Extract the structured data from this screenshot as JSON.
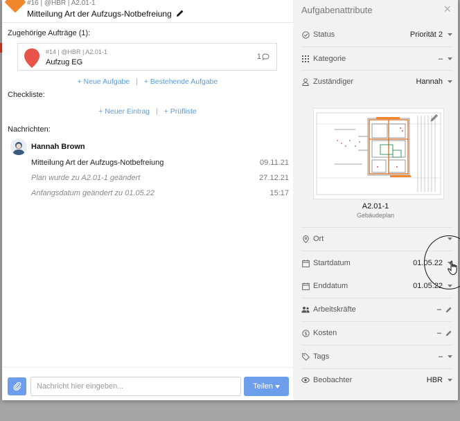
{
  "task": {
    "meta": "#16 | @HBR | A2.01-1",
    "title": "Mitteilung Art der Aufzugs-Notbefreiung"
  },
  "related": {
    "label": "Zugehörige Aufträge (1):",
    "card": {
      "meta": "#14 | @HBR | A2.01-1",
      "title": "Aufzug EG",
      "comment_count": "1"
    },
    "new_task_link": "+ Neue Aufgabe",
    "separator": "|",
    "existing_task_link": "+ Bestehende Aufgabe"
  },
  "checklist": {
    "label": "Checkliste:",
    "new_entry_link": "+ Neuer Eintrag",
    "separator": "|",
    "checklist_link": "+ Prüfliste"
  },
  "messages": {
    "label": "Nachrichten:",
    "author": "Hannah Brown",
    "items": [
      {
        "text": "Mitteilung Art der Aufzugs-Notbefreiung",
        "date": "09.11.21"
      },
      {
        "text": "Plan wurde zu A2.01-1 geändert",
        "date": "27.12.21"
      },
      {
        "text": "Anfangsdatum geändert zu 01.05.22",
        "date": "15:17"
      }
    ]
  },
  "composer": {
    "placeholder": "Nachricht hier eingeben...",
    "send_label": "Teilen"
  },
  "attributes": {
    "title": "Aufgabenattribute",
    "status_label": "Status",
    "status_value": "Priorität 2",
    "category_label": "Kategorie",
    "category_value": "–",
    "assignee_label": "Zuständiger",
    "assignee_value": "Hannah",
    "plan_name": "A2.01-1",
    "plan_type": "Gebäudeplan",
    "location_label": "Ort",
    "start_label": "Startdatum",
    "start_value": "01.05.22",
    "end_label": "Enddatum",
    "end_value": "01.05.22",
    "workers_label": "Arbeitskräfte",
    "workers_value": "–",
    "costs_label": "Kosten",
    "costs_value": "–",
    "tags_label": "Tags",
    "tags_value": "–",
    "observer_label": "Beobachter",
    "observer_value": "HBR"
  },
  "colors": {
    "accent": "#6d9eeb",
    "link": "#5b9bd5",
    "task_marker": "#f0872d",
    "pin": "#e8534a"
  },
  "icons": [
    "task-diamond-icon",
    "pencil-icon",
    "location-pin-icon",
    "comment-icon",
    "paperclip-icon",
    "caret-down-icon",
    "close-icon",
    "status-check-icon",
    "category-grid-icon",
    "user-icon",
    "map-pin-icon",
    "calendar-icon",
    "people-icon",
    "dollar-icon",
    "tag-icon",
    "eye-icon",
    "hand-cursor-icon"
  ]
}
